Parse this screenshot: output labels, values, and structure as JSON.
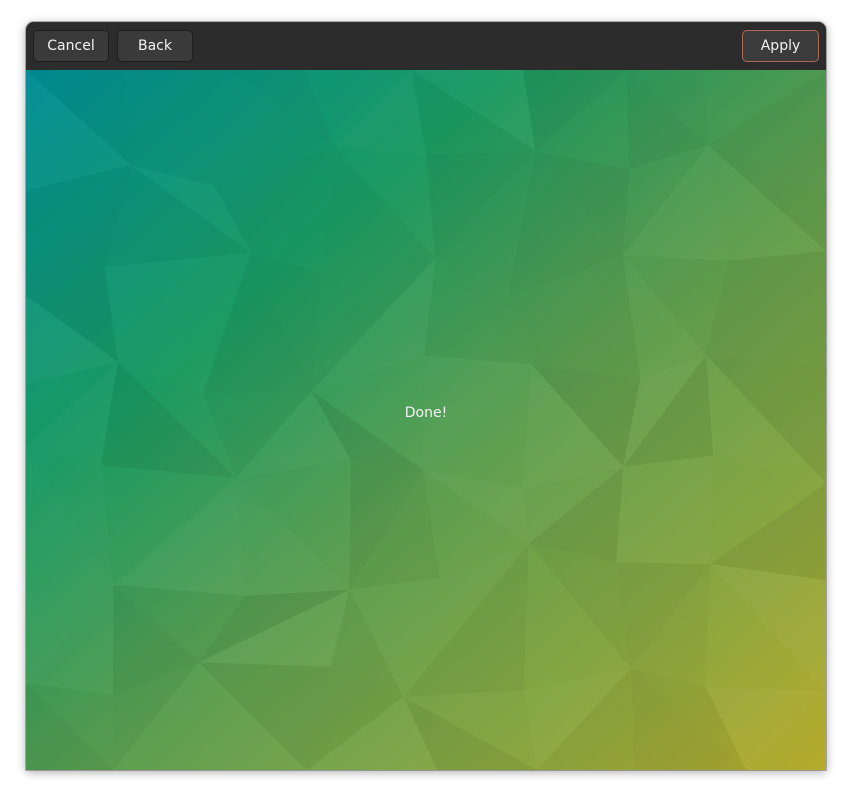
{
  "headerbar": {
    "cancel_label": "Cancel",
    "back_label": "Back",
    "apply_label": "Apply"
  },
  "main": {
    "status_text": "Done!",
    "background": {
      "description_colors": {
        "top_left": "#008f92",
        "center": "#5a9e53",
        "bottom_right": "#b3aa2e"
      }
    }
  },
  "colors": {
    "headerbar_bg": "#2c2c2c",
    "button_bg": "#3a3a3a",
    "apply_border": "#b06a55",
    "text": "#f2f2f2"
  }
}
